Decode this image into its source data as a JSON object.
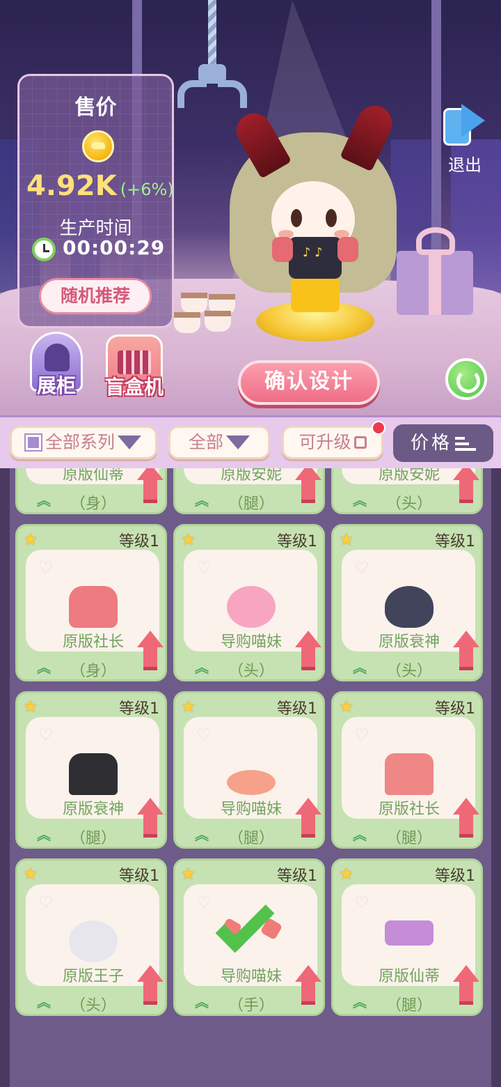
{
  "colors": {
    "accent": "#ef6d87",
    "panel": "#c6e2b2",
    "coin": "#f7b512",
    "sort_bg": "#6b5a85"
  },
  "price_panel": {
    "title": "售价",
    "price": "4.92K",
    "change": "(+6%)",
    "production_label": "生产时间",
    "production_time": "00:00:29",
    "random_button": "随机推荐"
  },
  "exit": {
    "label": "退出",
    "icon": "exit-arrow-icon"
  },
  "actions": {
    "cabinet": "展柜",
    "blind_box": "盲盒机",
    "confirm": "确认设计"
  },
  "filters": {
    "series": "全部系列",
    "type": "全部",
    "upgradable": "可升级",
    "sort": "价格"
  },
  "items": [
    {
      "level": "",
      "name": "原版仙蒂",
      "part": "（身）",
      "item_style": "it-skirt-purple",
      "selected": false
    },
    {
      "level": "",
      "name": "原版安妮",
      "part": "（腿）",
      "item_style": "it-green",
      "selected": false
    },
    {
      "level": "",
      "name": "原版安妮",
      "part": "（头）",
      "item_style": "it-yellow-head",
      "selected": false
    },
    {
      "level": "等级1",
      "name": "原版社长",
      "part": "（身）",
      "item_style": "it-shirt",
      "selected": false
    },
    {
      "level": "等级1",
      "name": "导购喵妹",
      "part": "（头）",
      "item_style": "it-head-pink",
      "selected": false
    },
    {
      "level": "等级1",
      "name": "原版衰神",
      "part": "（头）",
      "item_style": "it-head-dark",
      "selected": false
    },
    {
      "level": "等级1",
      "name": "原版衰神",
      "part": "（腿）",
      "item_style": "it-pants-black",
      "selected": false
    },
    {
      "level": "等级1",
      "name": "导购喵妹",
      "part": "（腿）",
      "item_style": "it-skirt",
      "selected": false
    },
    {
      "level": "等级1",
      "name": "原版社长",
      "part": "（腿）",
      "item_style": "it-pants-pink",
      "selected": false
    },
    {
      "level": "等级1",
      "name": "原版王子",
      "part": "（头）",
      "item_style": "it-head-white",
      "selected": false
    },
    {
      "level": "等级1",
      "name": "导购喵妹",
      "part": "（手）",
      "item_style": "it-hands",
      "selected": true
    },
    {
      "level": "等级1",
      "name": "原版仙蒂",
      "part": "（腿）",
      "item_style": "it-purple",
      "selected": false
    }
  ]
}
